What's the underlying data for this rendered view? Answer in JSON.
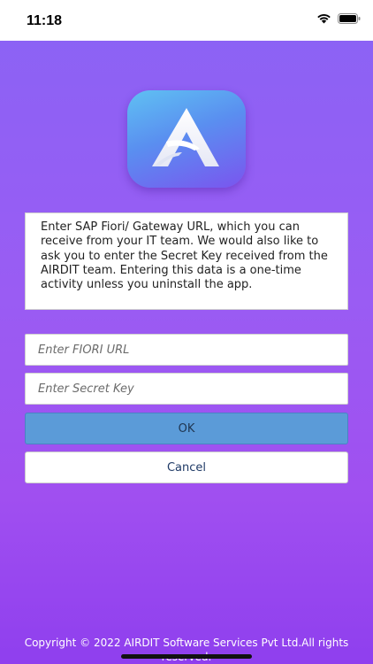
{
  "status_bar": {
    "time": "11:18",
    "icons": [
      "wifi-icon",
      "battery-icon"
    ]
  },
  "logo": {
    "icon": "airdit-a-logo-icon",
    "colors": [
      "#5fc1f3",
      "#5a8ef0",
      "#7a55ef"
    ]
  },
  "info": {
    "text": "Enter SAP Fiori/ Gateway URL, which you can receive from your IT team. We would also like to ask you to enter the Secret Key received from the AIRDIT team. Entering this data is a one-time activity unless you uninstall the app."
  },
  "form": {
    "url_placeholder": "Enter FIORI URL",
    "url_value": "",
    "key_placeholder": "Enter Secret Key",
    "key_value": "",
    "ok_label": "OK",
    "cancel_label": "Cancel"
  },
  "footer": {
    "copyright_line1": "Copyright © 2022 AIRDIT Software Services Pvt Ltd.All rights",
    "copyright_line2": "reserved."
  },
  "colors": {
    "background_top": "#8a63f5",
    "background_bottom": "#8f3fee",
    "ok_button": "#5b9bd8"
  }
}
